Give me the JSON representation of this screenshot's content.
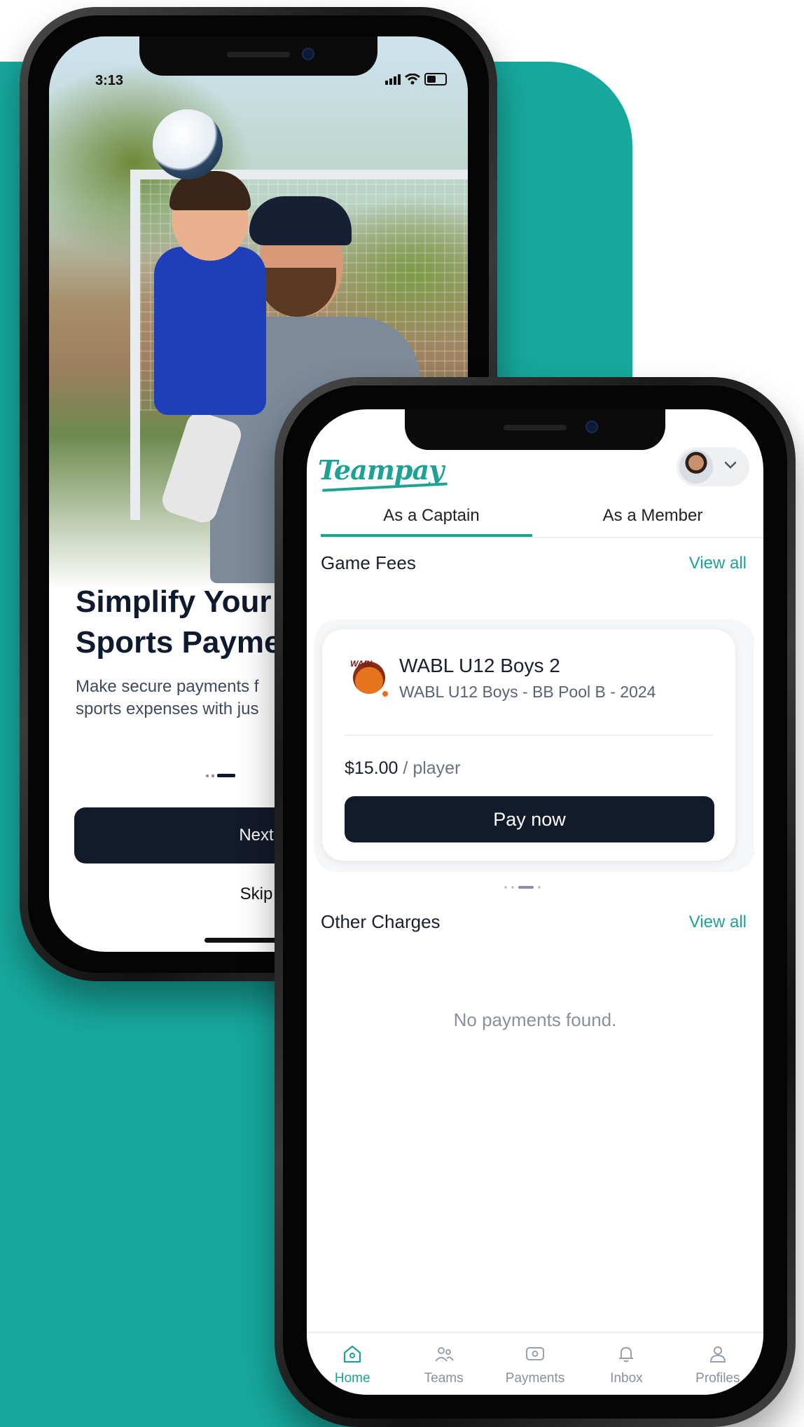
{
  "back_screen": {
    "status_time": "3:13",
    "title_line1": "Simplify Your",
    "title_line2": "Sports Payme",
    "desc_line1": "Make secure payments f",
    "desc_line2": "sports expenses with jus",
    "next_label": "Next",
    "skip_label": "Skip"
  },
  "app": {
    "logo": "Teampay",
    "tabs": [
      {
        "label": "As a Captain",
        "active": true
      },
      {
        "label": "As a Member",
        "active": false
      }
    ],
    "game_fees": {
      "title": "Game Fees",
      "view_all": "View all",
      "card": {
        "name": "WABL U12 Boys 2",
        "subtitle": "WABL U12 Boys - BB Pool B - 2024",
        "logo_text": "WABL",
        "price": "$15.00",
        "per": "/ player",
        "pay_label": "Pay now"
      }
    },
    "other_charges": {
      "title": "Other Charges",
      "view_all": "View all",
      "empty_text": "No payments found."
    },
    "bottom_nav": [
      {
        "label": "Home",
        "icon": "home-icon",
        "active": true
      },
      {
        "label": "Teams",
        "icon": "teams-icon",
        "active": false
      },
      {
        "label": "Payments",
        "icon": "payments-icon",
        "active": false
      },
      {
        "label": "Inbox",
        "icon": "bell-icon",
        "active": false
      },
      {
        "label": "Profiles",
        "icon": "user-icon",
        "active": false
      }
    ]
  },
  "colors": {
    "teal_bg": "#17a89d",
    "accent": "#1fa294",
    "button_dark": "#131a2a"
  }
}
